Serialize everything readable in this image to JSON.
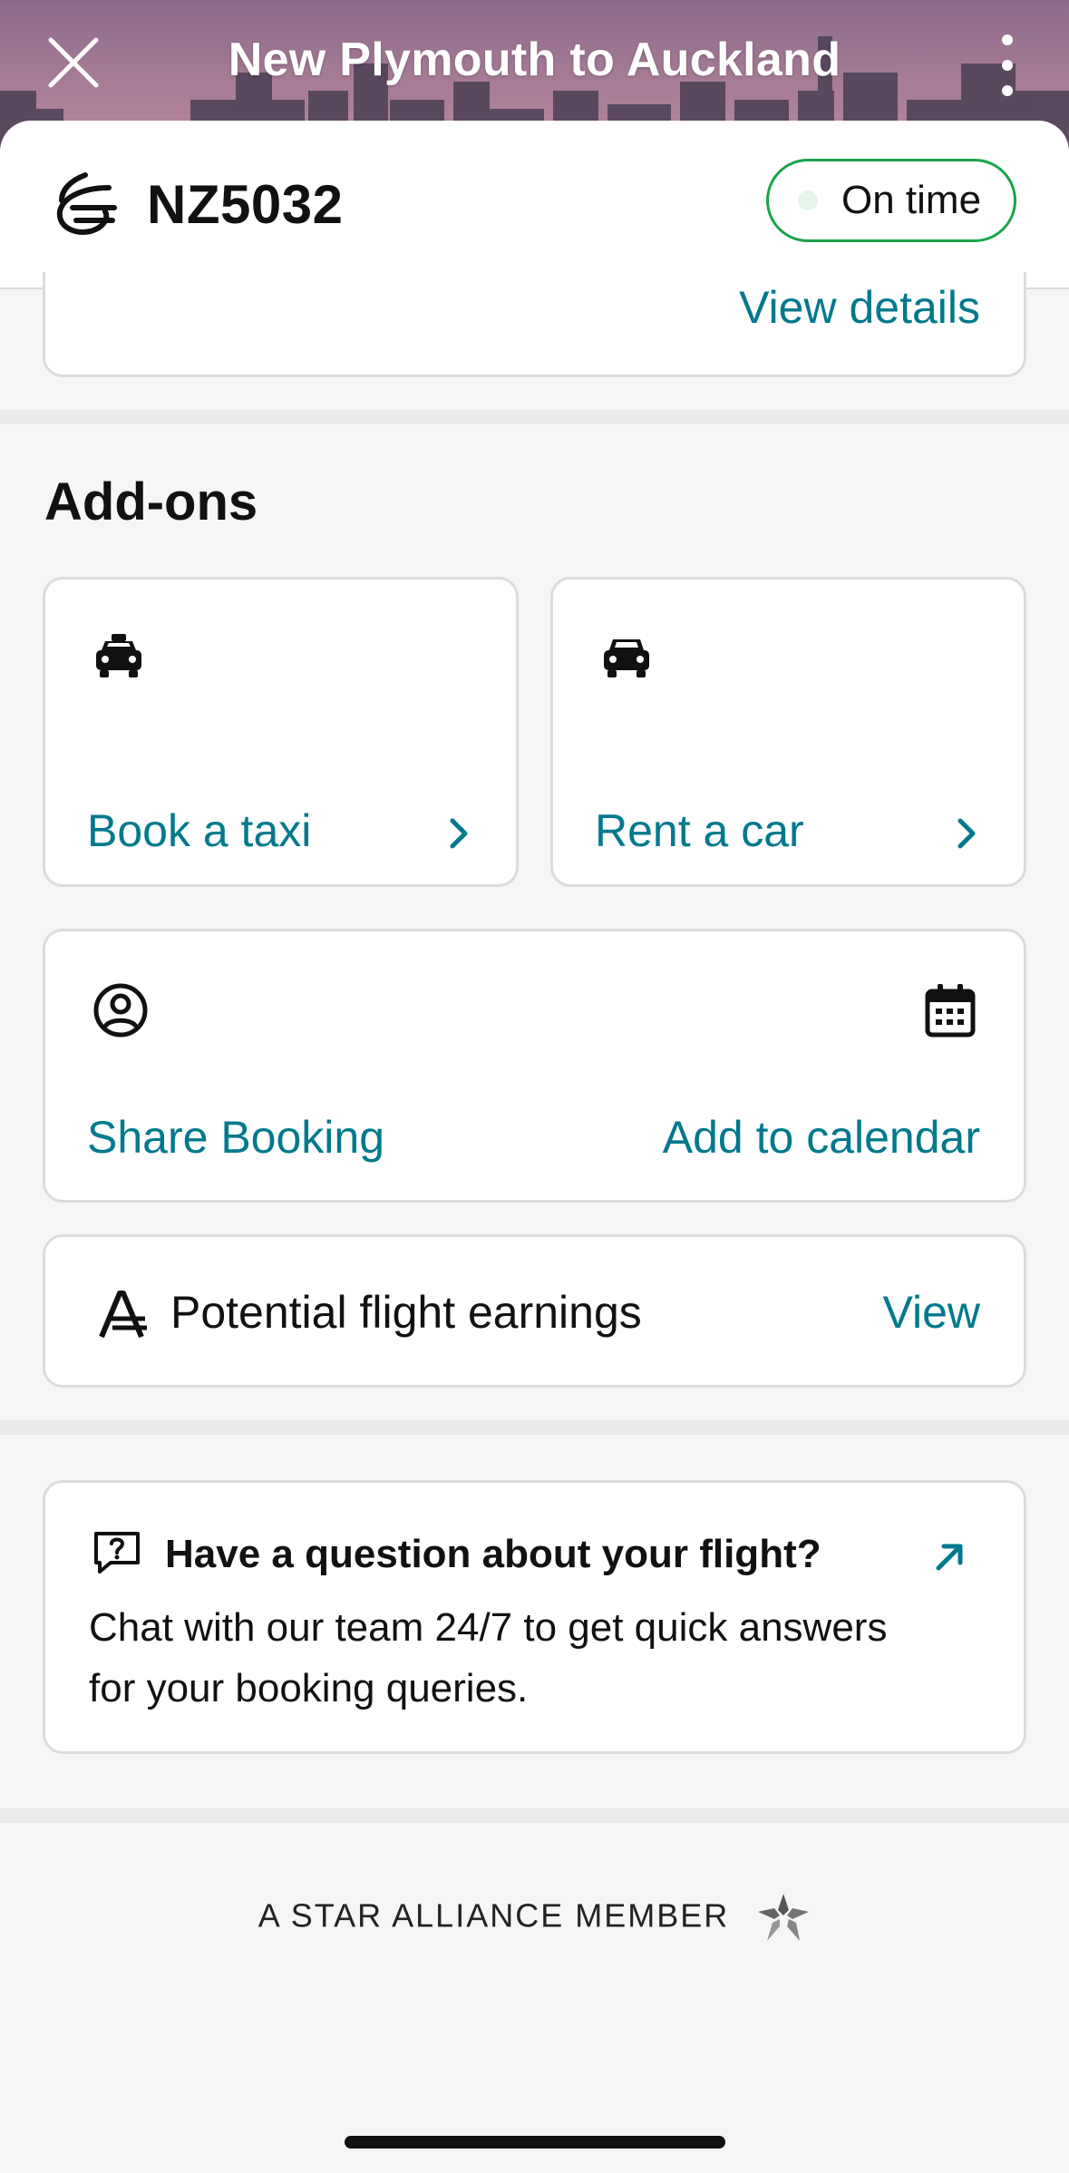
{
  "header": {
    "title": "New Plymouth to Auckland",
    "close_icon": "close-icon",
    "more_icon": "more-vertical-icon"
  },
  "flight": {
    "number": "NZ5032",
    "status": "On time",
    "status_color": "#1aa34a",
    "airline_logo": "koru-logo"
  },
  "top_card": {
    "link": "View details"
  },
  "addons": {
    "title": "Add-ons",
    "taxi": {
      "label": "Book a taxi",
      "icon": "taxi-icon"
    },
    "car": {
      "label": "Rent a car",
      "icon": "car-icon"
    },
    "share": {
      "label": "Share Booking",
      "icon": "user-circle-icon"
    },
    "calendar": {
      "label": "Add to calendar",
      "icon": "calendar-icon"
    }
  },
  "earnings": {
    "label": "Potential flight earnings",
    "link": "View",
    "icon": "airpoints-icon"
  },
  "question": {
    "title": "Have a question about your flight?",
    "body": "Chat with our team 24/7 to get quick answers for your booking queries.",
    "icon": "chat-question-icon",
    "arrow_icon": "external-arrow-icon"
  },
  "footer": {
    "alliance": "A STAR ALLIANCE MEMBER"
  },
  "colors": {
    "accent": "#00798c",
    "card_border": "#dcdcdc",
    "background": "#f6f6f6"
  }
}
